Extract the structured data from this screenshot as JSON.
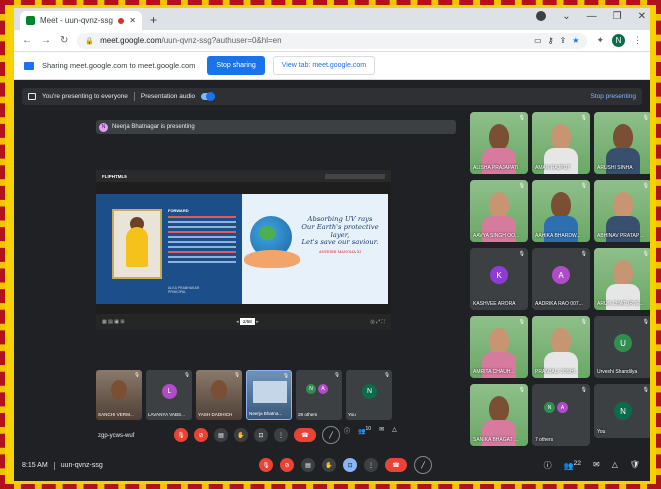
{
  "browser": {
    "tab_title": "Meet - uun-qvnz-ssg",
    "new_tab": "+",
    "url": "meet.google.com",
    "url_path": "/uun-qvnz-ssg?authuser=0&hl=en",
    "profile_initial": "N"
  },
  "share_bar": {
    "message": "Sharing meet.google.com to meet.google.com",
    "stop_button": "Stop sharing",
    "view_tab_button": "View tab: meet.google.com"
  },
  "presentation_bar": {
    "presenting_text": "You're presenting to everyone",
    "audio_label": "Presentation audio",
    "stop_label": "Stop presenting"
  },
  "presenter_chip": {
    "initial": "N",
    "text": "Neerja Bhatnagar is presenting"
  },
  "shared_screen": {
    "app_logo": "FLIPHTML5",
    "book_title": "FORWARD",
    "slogan": "Absorbing UV rays\nOur Earth's protective layer,\nLet's save our saviour.",
    "slogan_by": "ANVESHI MANOLIA  XI",
    "signature": "ALKA PRABHAKAR\nPRINCIPAL",
    "page": "2/58"
  },
  "grid": [
    {
      "name": "ALISHA PRAJAPATI",
      "kind": "video"
    },
    {
      "name": "AMAN RAJPUT",
      "kind": "video"
    },
    {
      "name": "ARUSHI SINHA",
      "kind": "video"
    },
    {
      "name": "AAVYA SINGH OO...",
      "kind": "video"
    },
    {
      "name": "AAHIKA BHARDW...",
      "kind": "video"
    },
    {
      "name": "ABHINAV PRATAP ...",
      "kind": "video"
    },
    {
      "name": "KASHVEE ARORA",
      "kind": "avatar",
      "initial": "K",
      "color": "#8e3bd6"
    },
    {
      "name": "AADRIKA RAO 007...",
      "kind": "avatar",
      "initial": "A",
      "color": "#b04cc9"
    },
    {
      "name": "ARUN CHATURVE...",
      "kind": "video"
    },
    {
      "name": "AMRITA CHAUH...",
      "kind": "video"
    },
    {
      "name": "PRANJALI JOSHI ...",
      "kind": "video"
    },
    {
      "name": "Urveshi Shandilya",
      "kind": "avatar",
      "initial": "U",
      "color": "#2f8f4e"
    },
    {
      "name": "SANIKA BHAGAT ...",
      "kind": "video"
    },
    {
      "name": "7 others",
      "kind": "others",
      "initials": [
        "N",
        "A"
      ]
    },
    {
      "name": "You",
      "kind": "avatar",
      "initial": "N",
      "color": "#0b6b4b"
    }
  ],
  "filmstrip": [
    {
      "name": "SANCHI VERM...",
      "kind": "video"
    },
    {
      "name": "LAVANYA VABS...",
      "kind": "avatar",
      "initial": "L",
      "color": "#b04cc9"
    },
    {
      "name": "YASH DADHICH",
      "kind": "video"
    },
    {
      "name": "Neerja Bhatna...",
      "kind": "screen"
    },
    {
      "name": "29 others",
      "kind": "others",
      "initials": [
        "N",
        "A"
      ]
    },
    {
      "name": "You",
      "kind": "avatar",
      "initial": "N",
      "color": "#0b6b4b"
    }
  ],
  "inner_meeting_code": "zgp-ycws-wuf",
  "inner_people_count": "10",
  "footer": {
    "time": "8:15 AM",
    "meeting_code": "uun-qvnz-ssg",
    "people_count": "22"
  }
}
